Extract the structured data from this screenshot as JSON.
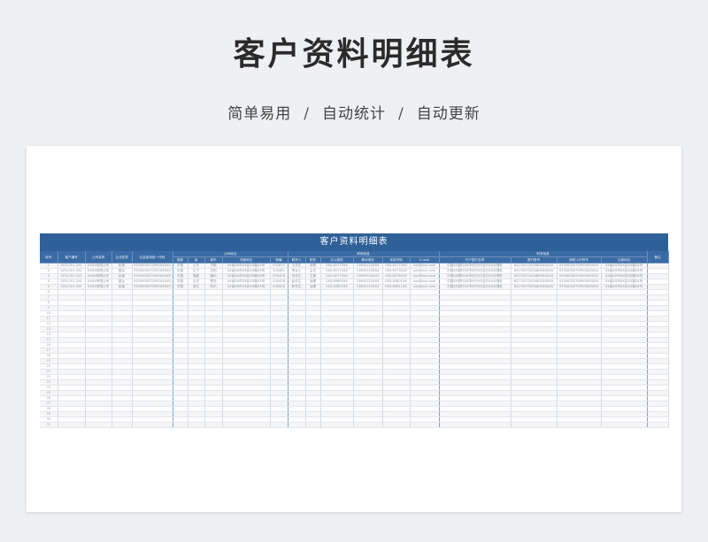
{
  "header": {
    "title": "客户资料明细表",
    "subtitle_parts": [
      "简单易用",
      "自动统计",
      "自动更新"
    ],
    "separator": "/"
  },
  "sheet": {
    "title": "客户资料明细表",
    "group_headers": {
      "company_address": "公司地址",
      "contact_info": "联络信息",
      "finance_info": "财务信息"
    },
    "columns": {
      "seq": "序号",
      "customer_id": "客户编号",
      "company_name": "公司名称",
      "company_type": "企业性质",
      "credit_code": "社会信用统一代码",
      "country": "国家",
      "province": "省",
      "city": "城市",
      "address": "详细地址",
      "zip": "邮编",
      "contact": "联系人",
      "position": "职务",
      "office_phone": "办公座机",
      "mobile": "移动电话",
      "fax": "传真号码",
      "email": "E-mail",
      "bank_name": "开户银行名称",
      "bank_account": "银行账号",
      "tax_id": "纳税人识别号",
      "reg_address": "注册地址",
      "remark": "备注"
    },
    "rows": [
      [
        "1",
        "SCD-001-201",
        "XXXX有限公司",
        "民营",
        "9150000070950XXXXX",
        "中国",
        "山东",
        "济南",
        "XX省XX市XX区XX路XX号",
        "552677",
        "王先生",
        "经理",
        "0XX-82773XX",
        "13690120XXX",
        "0XX-82774XX",
        "xxx@xxx.com",
        "中国XX银行XX市分行XX支行XX分理处",
        "6227007200480XXXXXX",
        "91500000709509XXXXX",
        "XX省XX市XX区XX路XX号",
        ""
      ],
      [
        "2",
        "SCD-001-202",
        "XXXX有限公司",
        "国企",
        "9150000070950XXXXX",
        "中国",
        "辽宁",
        "沈阳",
        "XX省XX市XX区XX路XX号",
        "325481",
        "李女士",
        "主任",
        "0XX-65729XX",
        "13690120XXX",
        "0XX-65730XX",
        "xxx@xxx.com",
        "中国XX银行XX市分行XX支行XX分理处",
        "6227007200480XXXXXX",
        "91500000709509XXXXX",
        "XX省XX市XX区XX路XX号",
        ""
      ],
      [
        "3",
        "SCD-001-203",
        "XXXX有限公司",
        "民营",
        "9150000070950XXXXX",
        "中国",
        "福建",
        "福州",
        "XX省XX市XX区XX路XX号",
        "430426",
        "孙先生",
        "主管",
        "0XX-82779XX",
        "13690120XXX",
        "0XX-82780XX",
        "xxx@xxx.com",
        "中国XX银行XX市分行XX支行XX分理处",
        "6227007200480XXXXXX",
        "91500000709509XXXXX",
        "XX省XX市XX区XX路XX号",
        ""
      ],
      [
        "4",
        "SCD-001-204",
        "XXXX有限公司",
        "国企",
        "9150000070950XXXXX",
        "中国",
        "山东",
        "青岛",
        "XX省XX市XX区XX路XX号",
        "430426",
        "赵先生",
        "经理",
        "0XX-65800XX",
        "13690120XXX",
        "0XX-65801XX",
        "xxx@xxx.com",
        "中国XX银行XX市分行XX支行XX分理处",
        "6227007200480XXXXXX",
        "91500000709509XXXXX",
        "XX省XX市XX区XX路XX号",
        ""
      ],
      [
        "5",
        "SCD-001-205",
        "XXXX有限公司",
        "民营",
        "9150000070950XXXXX",
        "中国",
        "浙江",
        "杭州",
        "XX省XX市XX区XX路XX号",
        "430426",
        "陈先生",
        "经理",
        "0XX-65810XX",
        "13690120XXX",
        "0XX-65811XX",
        "xxx@xxx.com",
        "中国XX银行XX市分行XX支行XX分理处",
        "6227007200480XXXXXX",
        "91500000709509XXXXX",
        "XX省XX市XX区XX路XX号",
        ""
      ]
    ],
    "empty_row_numbers": [
      "6",
      "7",
      "8",
      "9",
      "10",
      "11",
      "12",
      "13",
      "14",
      "15",
      "16",
      "17",
      "18",
      "19",
      "20",
      "21",
      "22",
      "23",
      "24",
      "25",
      "26",
      "27",
      "28",
      "29",
      "30",
      "31"
    ]
  }
}
